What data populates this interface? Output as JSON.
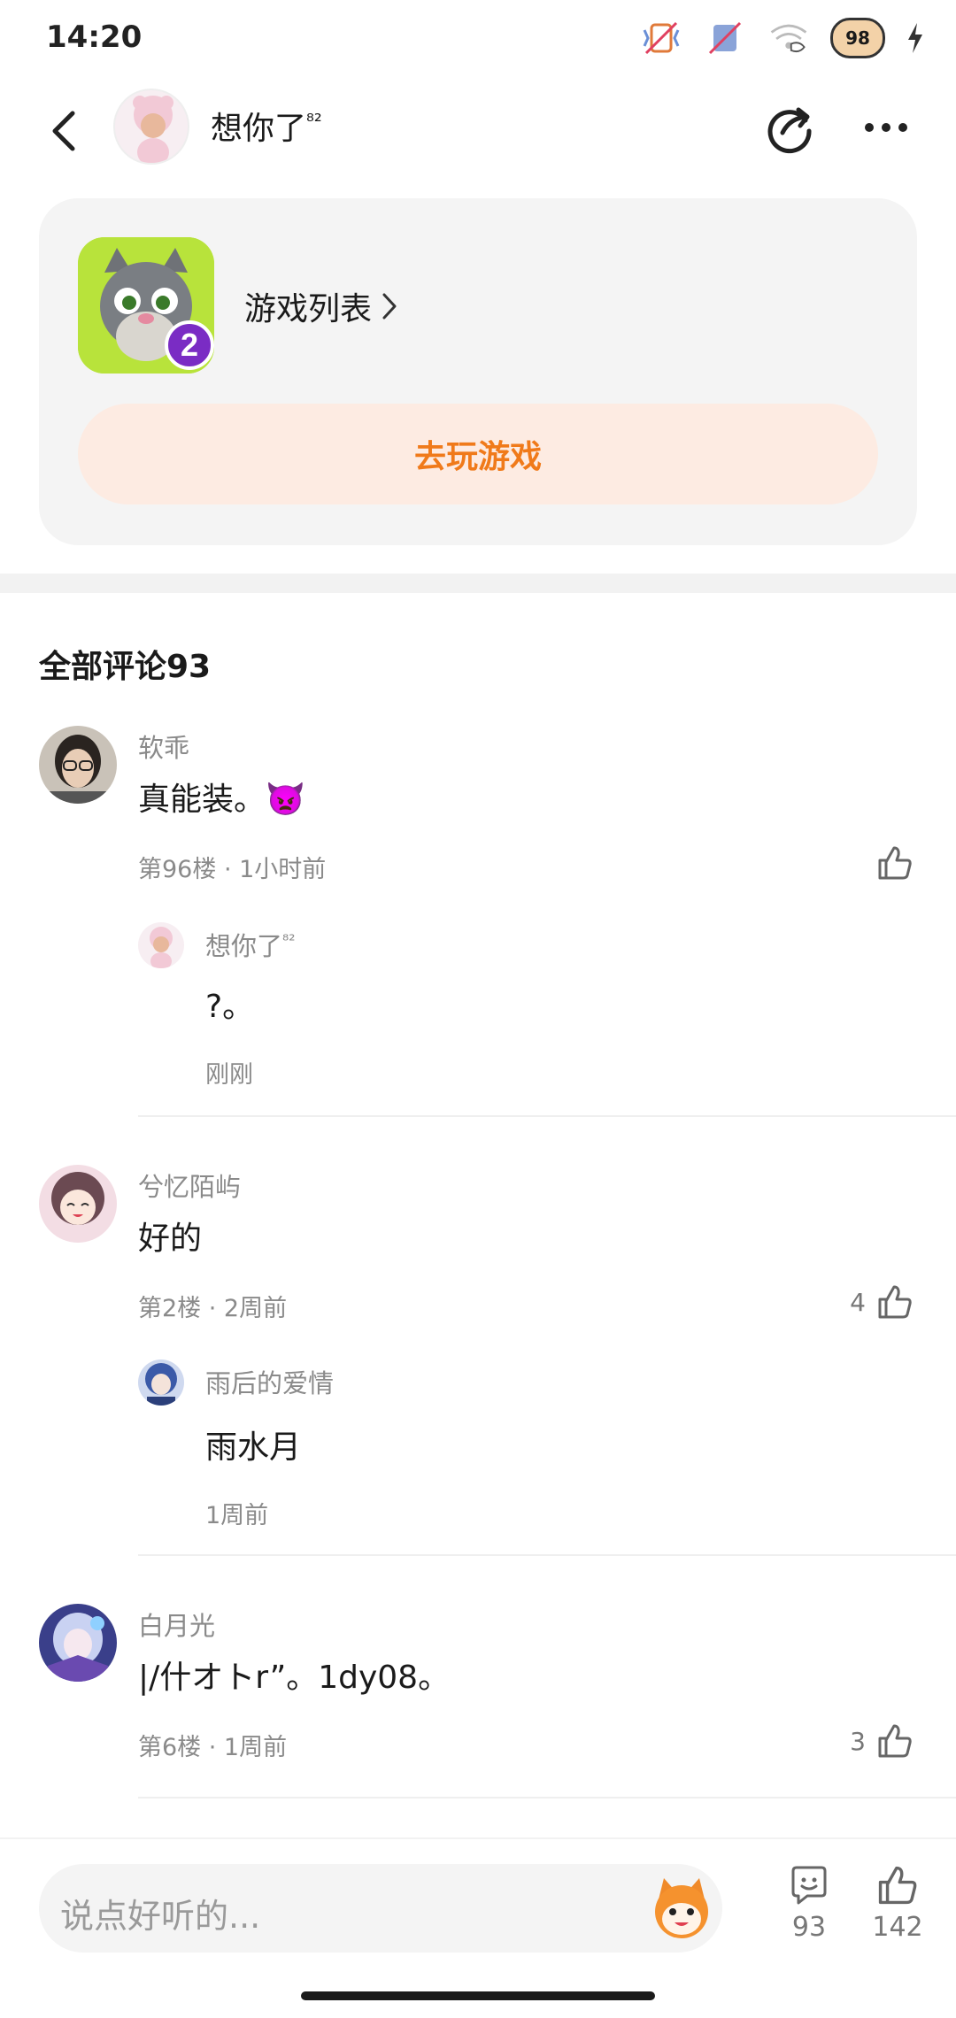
{
  "status_bar": {
    "time": "14:20",
    "battery_badge": "98"
  },
  "header": {
    "name": "想你了",
    "name_superscript": "⁸²"
  },
  "game_card": {
    "game_list_label": "游戏列表",
    "play_button_label": "去玩游戏",
    "game_icon_number": "2"
  },
  "comments": {
    "title": "全部评论93",
    "items": [
      {
        "user": "软乖",
        "text": "真能装。👿",
        "meta": "第96楼 · 1小时前",
        "likes": "",
        "reply": {
          "user": "想你了",
          "user_superscript": "⁸²",
          "text": "?。",
          "time": "刚刚"
        }
      },
      {
        "user": "兮忆陌屿",
        "text": "好的",
        "meta": "第2楼 · 2周前",
        "likes": "4",
        "reply": {
          "user": "雨后的爱情",
          "user_superscript": "",
          "text": "雨水月",
          "time": "1周前"
        }
      },
      {
        "user": "白月光",
        "text": "|/什オトr”。1dy08。",
        "meta": "第6楼 · 1周前",
        "likes": "3"
      }
    ]
  },
  "bottom_bar": {
    "input_placeholder": "说点好听的...",
    "comment_count": "93",
    "like_count": "142"
  },
  "colors": {
    "accent_orange": "#f07a1a",
    "play_button_bg": "#fdebe2",
    "muted_text": "#8a8a8a"
  }
}
